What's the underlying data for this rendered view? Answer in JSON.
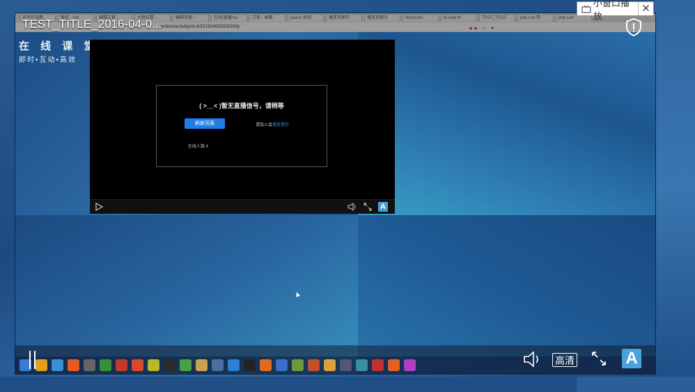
{
  "window": {
    "title": "TEST_TITLE_2016-04-0..."
  },
  "mini_window": {
    "label": "小窗口播放",
    "close_glyph": "✕"
  },
  "browser": {
    "tabs": [
      "名师在线教",
      "微信 - AM",
      "编辑文章 -",
      "主题设置 -",
      "编辑页面 -",
      "在线/直播/ca",
      "订单 - 桌面",
      "jquery 如何",
      "播放页面中",
      "播放页面中",
      "WooCom",
      "fe-load-fir",
      "TEST_TITLE",
      "php curl 带",
      "php curl"
    ],
    "url": "online/activity/d=A2016040500000dy"
  },
  "logo": {
    "main": "在 线 课 堂",
    "sub": "即时•互动•高效"
  },
  "video": {
    "notice": "( >__< )暂无直播信号，请稍等",
    "refresh_label": "刷新页面",
    "join_prefix": "请加入会",
    "join_link": "课音提示",
    "online_count": "在线人数:4",
    "logo_letter": "A"
  },
  "controls": {
    "quality_label": "高清",
    "brand_letter": "A"
  },
  "colors": {
    "accent_blue": "#1e7fe8",
    "brand_blue": "#4aa3dc"
  },
  "taskbar": {
    "icons": [
      "ie-icon",
      "chrome-icon",
      "explorer-icon",
      "firefox-icon",
      "app-icon",
      "chart-icon",
      "media-icon",
      "dict-icon",
      "a-icon",
      "obs-icon",
      "green-icon",
      "folder-icon",
      "search-icon",
      "globe-icon",
      "qq-icon",
      "firefox2-icon",
      "vbox-icon",
      "notes-icon",
      "ppt-icon",
      "chrome2-icon",
      "lock-icon",
      "image-icon",
      "bird-icon",
      "firefox3-icon",
      "color-icon"
    ]
  }
}
